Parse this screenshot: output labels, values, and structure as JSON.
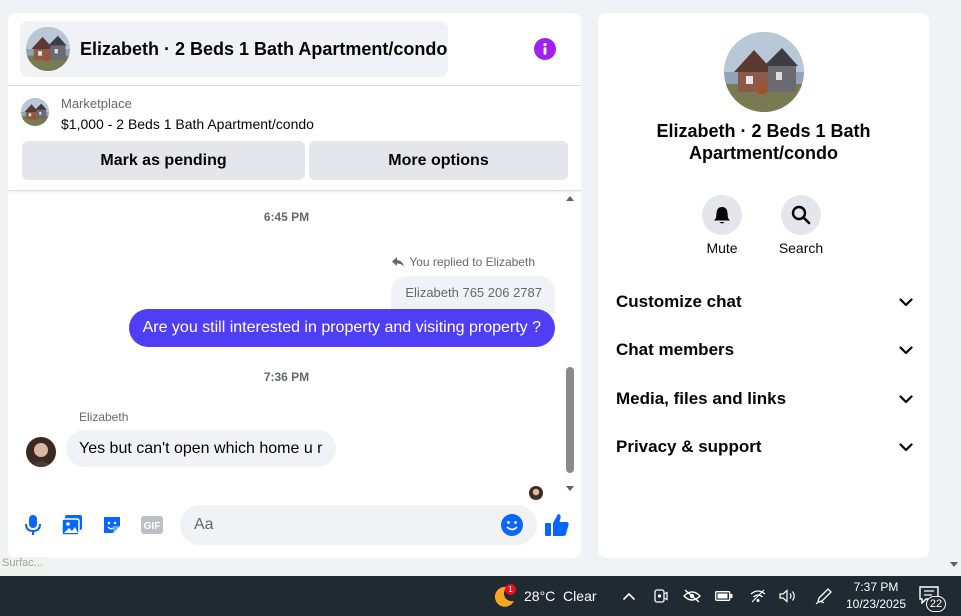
{
  "chat": {
    "header_title": "Elizabeth · 2 Beds 1 Bath Apartment/condo",
    "listing": {
      "source": "Marketplace",
      "title": "$1,000 - 2 Beds 1 Bath Apartment/condo",
      "mark_pending_label": "Mark as pending",
      "more_options_label": "More options"
    },
    "messages": {
      "timestamp_1": "6:45 PM",
      "reply_note": "You replied to Elizabeth",
      "quoted_text": "Elizabeth 765 206 2787",
      "outgoing_text": "Are you still interested in property and visiting property ?",
      "timestamp_2": "7:36 PM",
      "sender_name": "Elizabeth",
      "incoming_text": "Yes but can't open which home u r"
    },
    "composer": {
      "placeholder": "Aa",
      "gif_label": "GIF"
    }
  },
  "info_panel": {
    "name": "Elizabeth · 2 Beds 1 Bath Apartment/condo",
    "mute_label": "Mute",
    "search_label": "Search",
    "sections": [
      "Customize chat",
      "Chat members",
      "Media, files and links",
      "Privacy & support"
    ]
  },
  "background": {
    "ghost_text": "Surfac..."
  },
  "taskbar": {
    "weather_badge": "1",
    "weather": "28°C  Clear",
    "time": "7:37 PM",
    "date": "10/23/2025",
    "notification_count": "22"
  },
  "colors": {
    "outgoing_bubble": "#4f3ef5",
    "accent": "#0866ff",
    "info_icon": "#a020f0",
    "taskbar": "#1f2a33"
  }
}
